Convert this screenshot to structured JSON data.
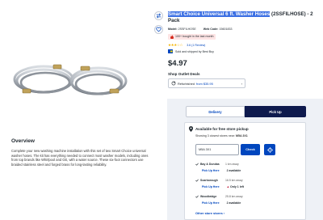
{
  "product": {
    "title_highlighted": "Smart Choice Universal 6 ft. Washer Hoses",
    "title_rest": " (2SSFILHOSE) - 2 Pack",
    "model_label": "Model:",
    "model_value": "2SSFILHOSE",
    "sku_label": "Web Code:",
    "sku_value": "15601833",
    "bought_badge": "100+ bought in the last month",
    "rating_stars": "★★★☆☆",
    "reviews_link": "3.6 (1 Review)",
    "sold_by": "Sold and shipped by Best Buy",
    "price": "$4.97"
  },
  "icons": {
    "compare": "compare-icon",
    "save": "heart-icon"
  },
  "outlet": {
    "title": "Shop Outlet Deals",
    "refurbished_label": "Refurbished",
    "refurbished_from": "from $35.95",
    "chevron": "›"
  },
  "overview": {
    "title": "Overview",
    "text": "Complete your new washing machine installation with this set of two Smart Choice universal washer hoses. The kit has everything needed to connect most washer models, including ones from top brands like Whirlpool and GE, with a water source. These six-foot connectors use braided stainless steel and forged brass for long-lasting reliability."
  },
  "fulfillment": {
    "tab_delivery": "Delivery",
    "tab_pickup": "Pick Up",
    "available_title": "Available for free store pickup",
    "showing_prefix": "Showing 3 closest stores near:",
    "showing_zip": "M5A 3X1",
    "zip_value": "M5A 3X1",
    "check_label": "Check",
    "stores": [
      {
        "name": "Bay & Dundas",
        "distance": "1 km away",
        "when": "Pick Up Here",
        "availability": "2 available",
        "warning": false
      },
      {
        "name": "Scarborough",
        "distance": "16.5 km away",
        "when": "Pick Up Here",
        "availability": "Only 1 left",
        "warning": true
      },
      {
        "name": "Woodbridge",
        "distance": "25.8 km away",
        "when": "Pick Up Here",
        "availability": "2 available",
        "warning": false
      }
    ],
    "other_stores": "Other store stores ›"
  },
  "colors": {
    "brand_blue": "#0046be",
    "navy": "#0e1a4d",
    "highlight": "#3b6fe3",
    "star": "#f5b400",
    "panel_bg": "#eef1f6"
  }
}
